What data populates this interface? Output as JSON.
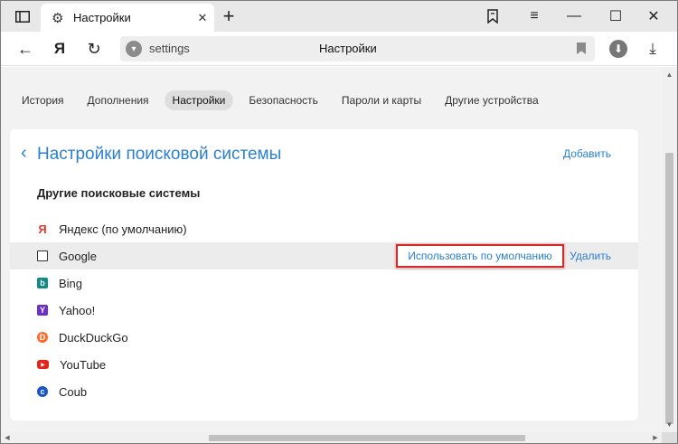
{
  "tab": {
    "title": "Настройки",
    "close_glyph": "✕",
    "new_tab_glyph": "+"
  },
  "window_controls": {
    "bookmarks_glyph": "⛉",
    "menu_glyph": "≡",
    "minimize_glyph": "—",
    "maximize_glyph": "☐",
    "close_glyph": "✕"
  },
  "toolbar": {
    "back_glyph": "←",
    "yandex_glyph": "Я",
    "reload_glyph": "↻",
    "address": "settings",
    "page_title": "Настройки",
    "download_glyph": "⤓"
  },
  "settings_nav": [
    {
      "label": "История",
      "active": false
    },
    {
      "label": "Дополнения",
      "active": false
    },
    {
      "label": "Настройки",
      "active": true
    },
    {
      "label": "Безопасность",
      "active": false
    },
    {
      "label": "Пароли и карты",
      "active": false
    },
    {
      "label": "Другие устройства",
      "active": false
    }
  ],
  "card": {
    "back_glyph": "‹",
    "title": "Настройки поисковой системы",
    "add_label": "Добавить",
    "section_title": "Другие поисковые системы",
    "default_action_label": "Использовать по умолчанию",
    "delete_label": "Удалить"
  },
  "engines": [
    {
      "name": "Яндекс (по умолчанию)",
      "icon": "yandex-icon",
      "glyph": "Я"
    },
    {
      "name": "Google",
      "icon": "google-icon",
      "glyph": ""
    },
    {
      "name": "Bing",
      "icon": "bing-icon",
      "glyph": "b"
    },
    {
      "name": "Yahoo!",
      "icon": "yahoo-icon",
      "glyph": "Y"
    },
    {
      "name": "DuckDuckGo",
      "icon": "duckduckgo-icon",
      "glyph": "D"
    },
    {
      "name": "YouTube",
      "icon": "youtube-icon",
      "glyph": "▶"
    },
    {
      "name": "Coub",
      "icon": "coub-icon",
      "glyph": "c"
    }
  ],
  "colors": {
    "link": "#2b7fd0",
    "highlight_border": "#d02b2b",
    "hover_row": "#ececec"
  }
}
